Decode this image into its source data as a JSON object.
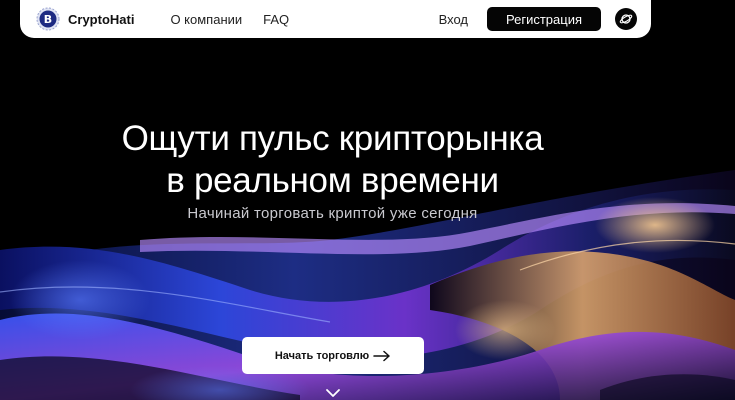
{
  "header": {
    "logo_text": "CryptoHati",
    "logo_icon": "bitcoin-badge-icon",
    "nav": [
      {
        "label": "О компании"
      },
      {
        "label": "FAQ"
      }
    ],
    "login_label": "Вход",
    "register_label": "Регистрация",
    "theme_icon": "planet-icon"
  },
  "hero": {
    "title_line1": "Ощути пульс крипторынка",
    "title_line2": "в реальном времени",
    "subtitle": "Начинай торговать криптой уже сегодня",
    "cta_label": "Начать торговлю",
    "cta_icon": "arrow-right-icon",
    "scroll_icon": "chevron-down-icon"
  },
  "colors": {
    "background": "#000000",
    "header_bg": "#ffffff",
    "button_dark": "#050505",
    "swirl_blue": "#2a3cc8",
    "swirl_purple": "#7a3ad0",
    "swirl_gold": "#d8a060"
  }
}
